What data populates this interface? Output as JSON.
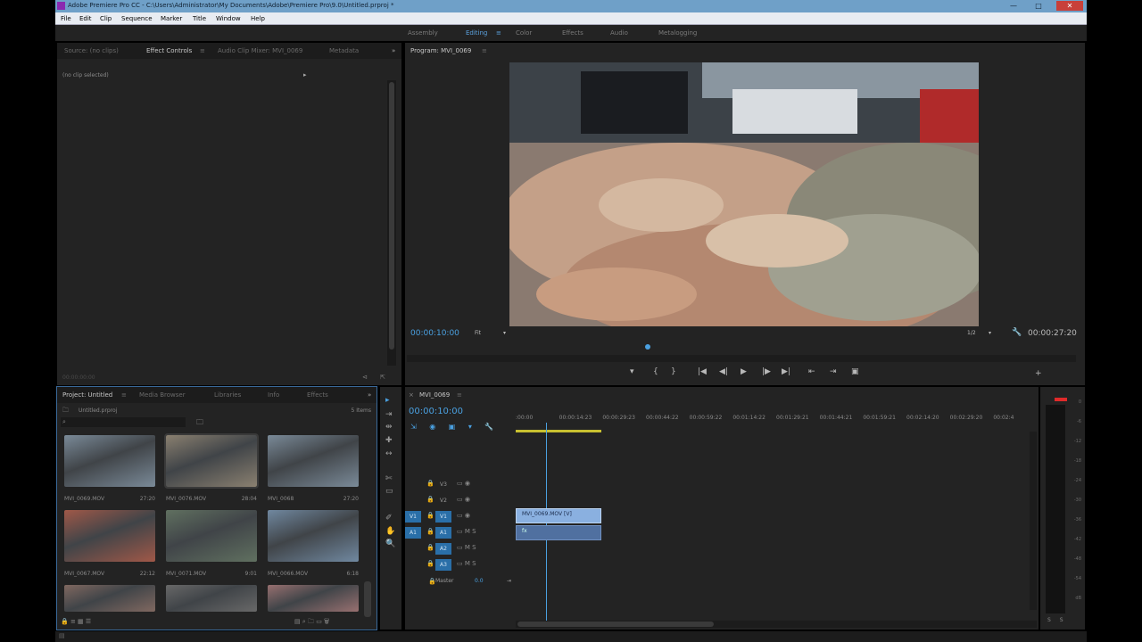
{
  "window": {
    "title": "Adobe Premiere Pro CC - C:\\Users\\Administrator\\My Documents\\Adobe\\Premiere Pro\\9.0\\Untitled.prproj *",
    "minimize": "—",
    "maximize": "□",
    "close": "✕"
  },
  "menu": [
    "File",
    "Edit",
    "Clip",
    "Sequence",
    "Marker",
    "Title",
    "Window",
    "Help"
  ],
  "workspaces": [
    {
      "label": "Assembly",
      "active": false
    },
    {
      "label": "Editing",
      "active": true
    },
    {
      "label": "Color",
      "active": false
    },
    {
      "label": "Effects",
      "active": false
    },
    {
      "label": "Audio",
      "active": false
    },
    {
      "label": "Metalogging",
      "active": false
    }
  ],
  "workspace_menu_icon": "≡",
  "source_panel": {
    "tabs": [
      "Source: (no clips)",
      "Effect Controls",
      "Audio Clip Mixer: MVI_0069",
      "Metadata"
    ],
    "active_tab": "Effect Controls",
    "tab_menu": "≡",
    "no_clip": "(no clip selected)",
    "timecode": "00:00:00:00"
  },
  "program_panel": {
    "title": "Program: MVI_0069",
    "tab_menu": "≡",
    "timecode_current": "00:00:10:00",
    "fit": "Fit",
    "resolution": "1/2",
    "timecode_duration": "00:00:27:20",
    "playhead_fraction": 0.36,
    "controls": [
      "▾",
      "{",
      "}",
      "|◀",
      "◀|",
      "▶",
      "|▶",
      "▶|",
      "⇤",
      "⇥",
      "▣"
    ],
    "add_button": "+"
  },
  "project_panel": {
    "tabs": [
      "Project: Untitled",
      "Media Browser",
      "Libraries",
      "Info",
      "Effects"
    ],
    "active_tab": "Project: Untitled",
    "tab_menu": "≡",
    "project_file": "Untitled.prproj",
    "item_count": "5 Items",
    "search_placeholder": "",
    "clips": [
      {
        "name": "MVI_0069.MOV",
        "duration": "27:20",
        "color": "#7a8a98"
      },
      {
        "name": "MVI_0076.MOV",
        "duration": "28:04",
        "color": "#8a8070"
      },
      {
        "name": "MVI_0068",
        "duration": "27:20",
        "color": "#7a8a98"
      },
      {
        "name": "MVI_0067.MOV",
        "duration": "22:12",
        "color": "#a05848"
      },
      {
        "name": "MVI_0071.MOV",
        "duration": "9:01",
        "color": "#607060"
      },
      {
        "name": "MVI_0066.MOV",
        "duration": "6:18",
        "color": "#7088a0"
      },
      {
        "name": "",
        "duration": "",
        "color": "#806860"
      },
      {
        "name": "",
        "duration": "",
        "color": "#686868"
      },
      {
        "name": "",
        "duration": "",
        "color": "#987070"
      }
    ]
  },
  "sequence_panel": {
    "title": "MVI_0069",
    "tab_menu": "≡",
    "timecode": "00:00:10:00",
    "ruler": [
      ":00:00",
      "00:00:14:23",
      "00:00:29:23",
      "00:00:44:22",
      "00:00:59:22",
      "00:01:14:22",
      "00:01:29:21",
      "00:01:44:21",
      "00:01:59:21",
      "00:02:14:20",
      "00:02:29:20",
      "00:02:4"
    ],
    "tracks": [
      {
        "name": "V3",
        "source": "",
        "type": "video"
      },
      {
        "name": "V2",
        "source": "",
        "type": "video"
      },
      {
        "name": "V1",
        "source": "V1",
        "type": "video"
      },
      {
        "name": "A1",
        "source": "A1",
        "type": "audio"
      },
      {
        "name": "A2",
        "source": "",
        "type": "audio"
      },
      {
        "name": "A3",
        "source": "",
        "type": "audio"
      }
    ],
    "master_label": "Master",
    "master_value": "0.0",
    "clip_name": "MVI_0069.MOV [V]",
    "audio_clip_label": "fx",
    "clip_start_fraction": 0.0,
    "clip_end_fraction": 0.165,
    "playhead_fraction": 0.059
  },
  "meter": {
    "db": [
      "0",
      "-6",
      "-12",
      "-18",
      "-24",
      "-30",
      "-36",
      "-42",
      "-48",
      "-54",
      "dB"
    ],
    "solo_labels": [
      "S",
      "S"
    ]
  },
  "tools": [
    "▸",
    "⇥",
    "⇹",
    "✚",
    "↔",
    "✄",
    "▭",
    "✐",
    "✋",
    "🔍"
  ]
}
